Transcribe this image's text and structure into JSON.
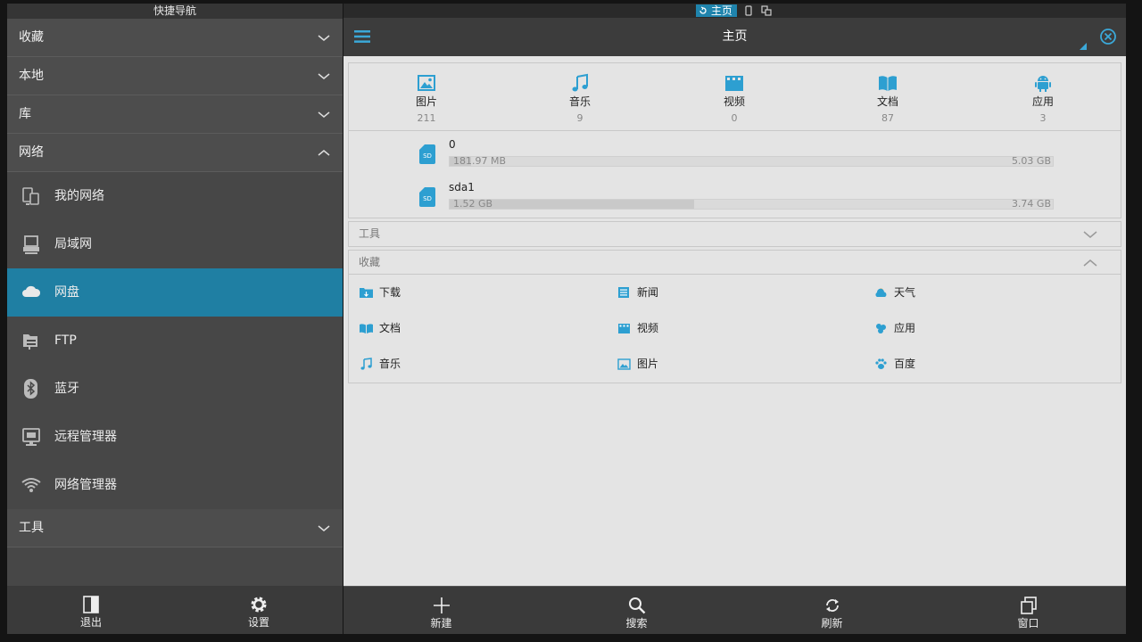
{
  "sidebar": {
    "title": "快捷导航",
    "sections": [
      {
        "label": "收藏"
      },
      {
        "label": "本地"
      },
      {
        "label": "库"
      },
      {
        "label": "网络"
      }
    ],
    "network_items": [
      {
        "label": "我的网络",
        "icon": "my-network-icon"
      },
      {
        "label": "局域网",
        "icon": "lan-icon"
      },
      {
        "label": "网盘",
        "icon": "cloud-icon"
      },
      {
        "label": "FTP",
        "icon": "ftp-icon"
      },
      {
        "label": "蓝牙",
        "icon": "bluetooth-icon"
      },
      {
        "label": "远程管理器",
        "icon": "remote-manager-icon"
      },
      {
        "label": "网络管理器",
        "icon": "wifi-icon"
      }
    ],
    "tools_label": "工具",
    "active_item": "网盘",
    "bottom": {
      "exit": "退出",
      "settings": "设置"
    }
  },
  "status": {
    "home_tab": "主页"
  },
  "toolbar": {
    "title": "主页"
  },
  "categories": [
    {
      "label": "图片",
      "count": "211",
      "icon": "image-icon"
    },
    {
      "label": "音乐",
      "count": "9",
      "icon": "music-icon"
    },
    {
      "label": "视频",
      "count": "0",
      "icon": "video-icon"
    },
    {
      "label": "文档",
      "count": "87",
      "icon": "document-icon"
    },
    {
      "label": "应用",
      "count": "3",
      "icon": "android-icon"
    }
  ],
  "storage": [
    {
      "name": "0",
      "used": "181.97 MB",
      "total": "5.03 GB",
      "fill": 0.035
    },
    {
      "name": "sda1",
      "used": "1.52 GB",
      "total": "3.74 GB",
      "fill": 0.406
    }
  ],
  "tools_section": {
    "label": "工具"
  },
  "favorites_section": {
    "label": "收藏"
  },
  "favorites": [
    {
      "label": "下载",
      "icon": "download-folder-icon"
    },
    {
      "label": "新闻",
      "icon": "news-icon"
    },
    {
      "label": "天气",
      "icon": "weather-icon"
    },
    {
      "label": "文档",
      "icon": "document-icon"
    },
    {
      "label": "视频",
      "icon": "video-icon"
    },
    {
      "label": "应用",
      "icon": "apps-icon"
    },
    {
      "label": "音乐",
      "icon": "music-icon"
    },
    {
      "label": "图片",
      "icon": "image-icon"
    },
    {
      "label": "百度",
      "icon": "baidu-paw-icon"
    }
  ],
  "bottom_bar": {
    "new": "新建",
    "search": "搜索",
    "refresh": "刷新",
    "window": "窗口"
  },
  "colors": {
    "accent": "#1f84ad",
    "active_bg": "#1f7fa3",
    "icon_blue": "#2d9fd1"
  }
}
